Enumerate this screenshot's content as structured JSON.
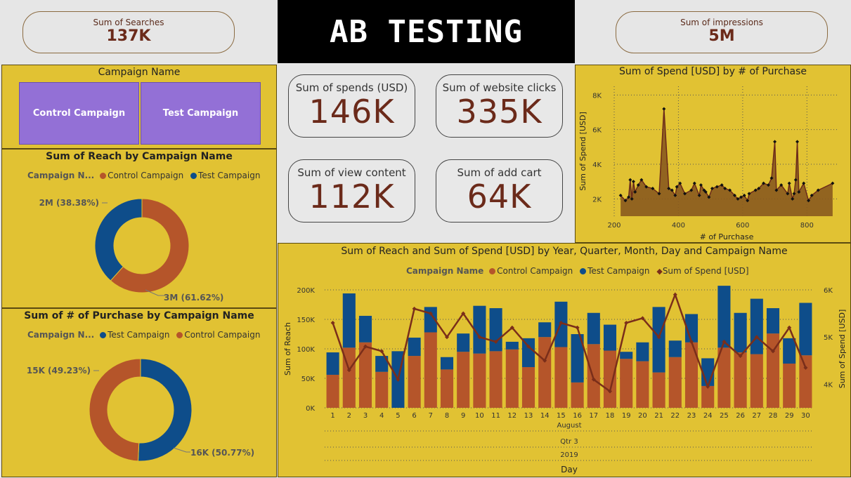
{
  "header": {
    "title": "AB TESTING",
    "searches": {
      "label": "Sum of Searches",
      "value": "137K"
    },
    "impressions": {
      "label": "Sum of impressions",
      "value": "5M"
    }
  },
  "kpis": {
    "spends": {
      "label": "Sum of spends (USD)",
      "value": "146K"
    },
    "clicks": {
      "label": "Sum of website clicks",
      "value": "335K"
    },
    "view": {
      "label": "Sum of view content",
      "value": "112K"
    },
    "cart": {
      "label": "Sum of add cart",
      "value": "64K"
    }
  },
  "slicer": {
    "title": "Campaign Name",
    "options": [
      "Control Campaign",
      "Test Campaign"
    ]
  },
  "colors": {
    "control": "#b5552a",
    "test": "#0e4d8a",
    "spend": "#7a2e1a",
    "panel": "#e1c233"
  },
  "chart_data": [
    {
      "type": "pie",
      "title": "Sum of Reach by Campaign Name",
      "legend_title": "Campaign N...",
      "categories": [
        "Control Campaign",
        "Test Campaign"
      ],
      "values": [
        3,
        2
      ],
      "labels": [
        "3M (61.62%)",
        "2M (38.38%)"
      ],
      "percent": [
        61.62,
        38.38
      ]
    },
    {
      "type": "pie",
      "title": "Sum of # of Purchase by Campaign Name",
      "legend_title": "Campaign N...",
      "categories": [
        "Test Campaign",
        "Control Campaign"
      ],
      "values": [
        16,
        15
      ],
      "labels": [
        "16K (50.77%)",
        "15K (49.23%)"
      ],
      "percent": [
        50.77,
        49.23
      ]
    },
    {
      "type": "area",
      "title": "Sum of Spend [USD] by # of Purchase",
      "xlabel": "# of Purchase",
      "ylabel": "Sum of Spend [USD]",
      "xlim": [
        200,
        900
      ],
      "ylim": [
        1000,
        8500
      ],
      "xticks": [
        "200",
        "400",
        "600",
        "800"
      ],
      "yticks": [
        "2K",
        "4K",
        "6K",
        "8K"
      ],
      "x": [
        220,
        235,
        245,
        250,
        255,
        260,
        265,
        275,
        285,
        300,
        320,
        340,
        355,
        370,
        380,
        390,
        395,
        405,
        420,
        440,
        450,
        465,
        470,
        480,
        485,
        495,
        505,
        520,
        535,
        545,
        560,
        575,
        585,
        595,
        605,
        615,
        620,
        640,
        650,
        665,
        680,
        690,
        700,
        705,
        720,
        740,
        745,
        755,
        760,
        765,
        770,
        775,
        790,
        805,
        815,
        835,
        880
      ],
      "y": [
        2200,
        1900,
        2100,
        3100,
        2000,
        3000,
        2400,
        2800,
        3100,
        2700,
        2600,
        2300,
        7200,
        2600,
        2500,
        2200,
        2700,
        2900,
        2300,
        2500,
        2900,
        2200,
        2800,
        2500,
        2400,
        2100,
        2600,
        2700,
        2800,
        2600,
        2500,
        2200,
        2000,
        2100,
        2200,
        1900,
        2300,
        2500,
        2600,
        2900,
        2800,
        3200,
        5300,
        2500,
        2800,
        2300,
        2900,
        2000,
        2300,
        3100,
        5300,
        2400,
        2900,
        1900,
        2200,
        2500,
        2900
      ]
    },
    {
      "type": "bar",
      "title": "Sum of Reach and Sum of Spend [USD] by Year, Quarter, Month, Day and Campaign Name",
      "legend_title": "Campaign Name",
      "legend": [
        "Control Campaign",
        "Test Campaign",
        "Sum of Spend [USD]"
      ],
      "categories": [
        "1",
        "2",
        "3",
        "4",
        "5",
        "6",
        "7",
        "8",
        "9",
        "10",
        "11",
        "12",
        "13",
        "14",
        "15",
        "16",
        "17",
        "18",
        "19",
        "20",
        "21",
        "22",
        "23",
        "24",
        "25",
        "26",
        "27",
        "28",
        "29",
        "30"
      ],
      "series": [
        {
          "name": "Control Campaign",
          "values": [
            56,
            102,
            111,
            61,
            0,
            88,
            128,
            65,
            95,
            92,
            96,
            99,
            69,
            120,
            103,
            43,
            108,
            97,
            83,
            79,
            60,
            86,
            111,
            37,
            102,
            94,
            91,
            126,
            75,
            89
          ]
        },
        {
          "name": "Test Campaign",
          "values": [
            38,
            92,
            45,
            27,
            96,
            31,
            43,
            21,
            31,
            81,
            73,
            13,
            49,
            25,
            77,
            82,
            53,
            44,
            12,
            32,
            111,
            28,
            48,
            47,
            105,
            67,
            94,
            43,
            43,
            89
          ]
        },
        {
          "name": "Sum of Spend [USD]",
          "values": [
            5300,
            4300,
            4800,
            4700,
            4100,
            5600,
            5500,
            5000,
            5500,
            5000,
            4900,
            5200,
            4800,
            4500,
            5300,
            5200,
            4100,
            3850,
            5300,
            5400,
            5000,
            5900,
            4900,
            3950,
            4900,
            4600,
            5000,
            4700,
            5200,
            4350
          ]
        }
      ],
      "ylabel": "Sum of Reach",
      "y2label": "Sum of Spend [USD]",
      "xlabel": "Day",
      "hierarchy": [
        "August",
        "Qtr 3",
        "2019"
      ],
      "yticks": [
        "0K",
        "50K",
        "100K",
        "150K",
        "200K"
      ],
      "y2ticks": [
        "4K",
        "5K",
        "6K"
      ],
      "ylim": [
        0,
        200
      ],
      "y2lim": [
        3500,
        6000
      ]
    }
  ]
}
